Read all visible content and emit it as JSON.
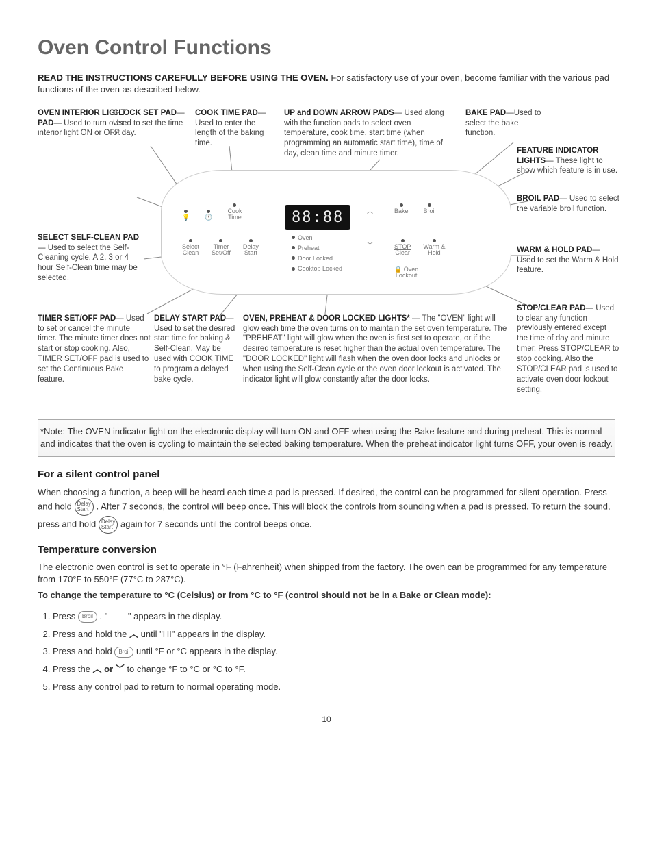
{
  "title": "Oven Control Functions",
  "intro_bold": "READ THE INSTRUCTIONS CAREFULLY BEFORE USING THE OVEN.",
  "intro_rest": " For satisfactory use of your oven, become familiar with the various pad functions of the oven as described below.",
  "callouts": {
    "clock_set": {
      "head": "CLOCK SET PAD",
      "body": "— Used to set the time of day."
    },
    "cook_time": {
      "head": "COOK TIME PAD",
      "body": "— Used to enter the length of the baking time."
    },
    "arrows": {
      "head": "UP and DOWN ARROW PADS",
      "body": "— Used along with the function pads to select oven temperature, cook time, start time (when programming an automatic start time), time of day, clean time and minute timer."
    },
    "bake": {
      "head": "BAKE PAD",
      "body": "—Used to select the bake function."
    },
    "feature": {
      "head": "FEATURE INDICATOR LIGHTS",
      "body": "— These light to show which feature is in use."
    },
    "light": {
      "head": "OVEN INTERIOR LIGHT PAD",
      "body": "— Used to turn oven interior light ON or OFF."
    },
    "broil": {
      "head": "BROIL PAD",
      "body": "— Used to select the variable broil function."
    },
    "selfclean": {
      "head": "SELECT SELF-CLEAN PAD",
      "body": "— Used to select the Self-Cleaning cycle. A 2, 3 or 4 hour Self-Clean time may be selected."
    },
    "warmhold": {
      "head": "WARM & HOLD PAD",
      "body": "— Used to set the Warm & Hold feature."
    },
    "stopclear": {
      "head": "STOP/CLEAR PAD",
      "body": "— Used to clear any function previously entered except the time of day and minute timer. Press STOP/CLEAR to stop cooking. Also the STOP/CLEAR pad is used to activate oven door lockout setting."
    },
    "timer": {
      "head": "TIMER SET/OFF PAD",
      "body": "— Used to set or cancel the minute timer. The minute timer does not start or stop cooking. Also, TIMER SET/OFF pad is used to set the Continuous Bake feature."
    },
    "delay": {
      "head": "DELAY START PAD",
      "body": "— Used to set the desired start time for baking & Self-Clean. May be used with COOK TIME to program a delayed bake cycle."
    },
    "lights": {
      "head": "OVEN, PREHEAT & DOOR LOCKED LIGHTS*",
      "body": " — The \"OVEN\" light will glow each time the oven turns on to maintain the set oven temperature. The \"PREHEAT\" light will glow when the oven is first set to operate, or if the desired temperature is reset higher than the actual oven temperature. The \"DOOR LOCKED\" light will flash when the oven door locks and unlocks or when using the Self-Clean cycle or the oven door lockout is activated. The indicator light will glow constantly after the door locks."
    }
  },
  "panel": {
    "display": "88:88",
    "pads_row1": [
      "",
      "",
      "Cook\nTime",
      "",
      "",
      "Bake",
      "Broil"
    ],
    "pads_row2": [
      "Select\nClean",
      "Timer\nSet/Off",
      "Delay\nStart",
      "",
      "",
      "STOP\nClear",
      "Warm &\nHold"
    ],
    "indicators": [
      "Oven",
      "Preheat",
      "Door Locked",
      "Cooktop Locked"
    ],
    "lockout": "Oven\nLockout"
  },
  "note": "*Note: The OVEN indicator light on the electronic display will turn ON and OFF when using the Bake feature and during preheat. This is normal and indicates that the oven is cycling to maintain the selected baking temperature. When the preheat indicator light turns OFF, your oven is ready.",
  "silent": {
    "heading": "For a silent control panel",
    "p1a": "When choosing a function, a beep will be heard each time a pad is pressed. If desired, the control can be programmed for silent operation. Press and hold ",
    "btn": "Delay\nStart",
    "p1b": ". After 7 seconds, the control will beep once. This will block the controls from sounding when a pad is pressed. To return the sound, press and hold ",
    "p1c": " again for 7 seconds until the control beeps once."
  },
  "temp": {
    "heading": "Temperature conversion",
    "intro": "The electronic oven control is set to operate in °F (Fahrenheit) when shipped from the factory. The oven can be programmed for any temperature from 170°F to 550°F (77°C to 287°C).",
    "subhead": "To change the temperature to °C (Celsius) or from °C to °F (control should not be in a Bake or Clean mode):",
    "steps": {
      "s1a": "Press ",
      "s1_btn": "Broil",
      "s1b": ". \"— —\" appears in the display.",
      "s2a": "Press and hold the ",
      "s2b": " until \"HI\" appears in the display.",
      "s3a": "Press and hold ",
      "s3_btn": "Broil",
      "s3b": " until °F or °C appears in the display.",
      "s4a": "Press the ",
      "s4_or": " or ",
      "s4b": " to change °F to °C or °C to °F.",
      "s5": "Press any control pad to return to normal operating mode."
    }
  },
  "page": "10"
}
